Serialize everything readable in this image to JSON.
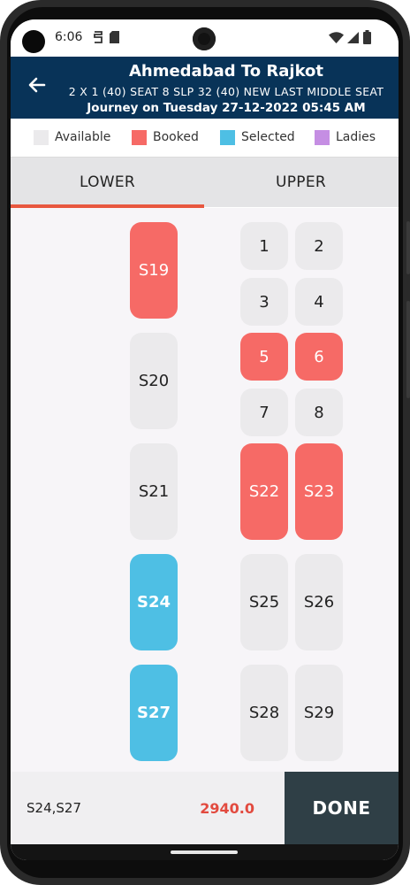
{
  "status_bar": {
    "time": "6:06"
  },
  "header": {
    "title": "Ahmedabad To Rajkot",
    "subtitle": "2 X 1 (40) SEAT 8 SLP 32 (40) NEW LAST MIDDLE SEAT",
    "journey": "Journey on Tuesday 27-12-2022 05:45 AM"
  },
  "legend": [
    {
      "label": "Available",
      "color": "#ebeaec"
    },
    {
      "label": "Booked",
      "color": "#f66a66"
    },
    {
      "label": "Selected",
      "color": "#4ebfe4"
    },
    {
      "label": "Ladies",
      "color": "#c58ee3"
    }
  ],
  "tabs": {
    "lower": "LOWER",
    "upper": "UPPER",
    "active": "LOWER"
  },
  "seats": {
    "s19": {
      "label": "S19",
      "status": "booked"
    },
    "s20": {
      "label": "S20",
      "status": "available"
    },
    "s21": {
      "label": "S21",
      "status": "available"
    },
    "s24": {
      "label": "S24",
      "status": "selected"
    },
    "s27": {
      "label": "S27",
      "status": "selected"
    },
    "1": {
      "label": "1",
      "status": "available"
    },
    "2": {
      "label": "2",
      "status": "available"
    },
    "3": {
      "label": "3",
      "status": "available"
    },
    "4": {
      "label": "4",
      "status": "available"
    },
    "5": {
      "label": "5",
      "status": "booked"
    },
    "6": {
      "label": "6",
      "status": "booked"
    },
    "7": {
      "label": "7",
      "status": "available"
    },
    "8": {
      "label": "8",
      "status": "available"
    },
    "s22": {
      "label": "S22",
      "status": "booked"
    },
    "s23": {
      "label": "S23",
      "status": "booked"
    },
    "s25": {
      "label": "S25",
      "status": "available"
    },
    "s26": {
      "label": "S26",
      "status": "available"
    },
    "s28": {
      "label": "S28",
      "status": "available"
    },
    "s29": {
      "label": "S29",
      "status": "available"
    }
  },
  "footer": {
    "selected_seats": "S24,S27",
    "total": "2940.0",
    "done_label": "DONE"
  }
}
